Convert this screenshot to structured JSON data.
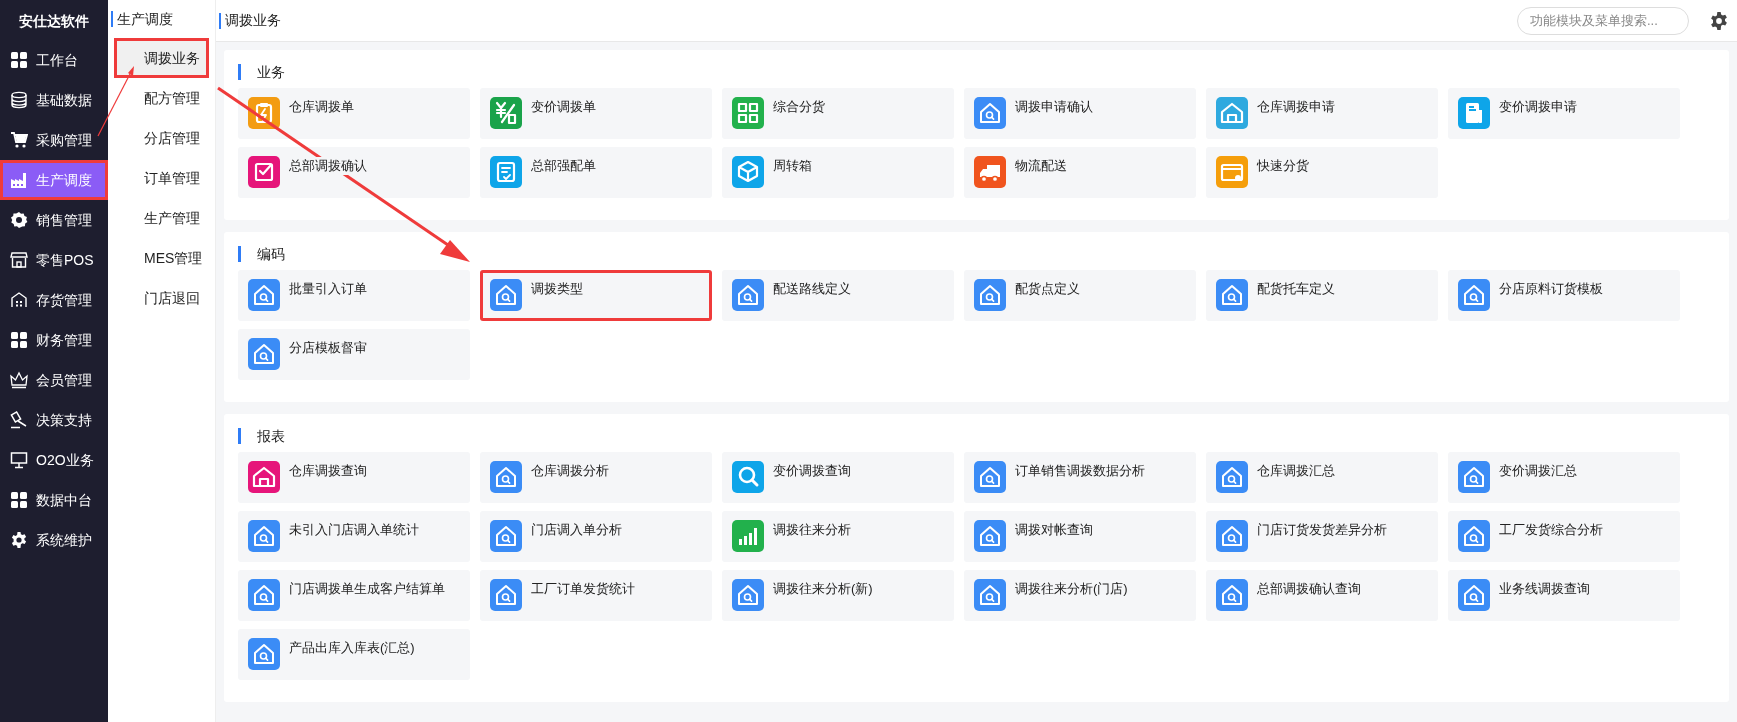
{
  "sidebar": {
    "logo": "安仕达软件",
    "items": [
      {
        "label": "工作台",
        "kind": "grid",
        "selected": false,
        "highlighted": false
      },
      {
        "label": "基础数据",
        "kind": "database",
        "selected": false,
        "highlighted": false
      },
      {
        "label": "采购管理",
        "kind": "cart",
        "selected": false,
        "highlighted": false
      },
      {
        "label": "生产调度",
        "kind": "factory",
        "selected": true,
        "highlighted": true
      },
      {
        "label": "销售管理",
        "kind": "sale",
        "selected": false,
        "highlighted": false
      },
      {
        "label": "零售POS",
        "kind": "store",
        "selected": false,
        "highlighted": false
      },
      {
        "label": "存货管理",
        "kind": "warehouse",
        "selected": false,
        "highlighted": false
      },
      {
        "label": "财务管理",
        "kind": "grid",
        "selected": false,
        "highlighted": false
      },
      {
        "label": "会员管理",
        "kind": "crown",
        "selected": false,
        "highlighted": false
      },
      {
        "label": "决策支持",
        "kind": "gavel",
        "selected": false,
        "highlighted": false
      },
      {
        "label": "O2O业务",
        "kind": "monitor",
        "selected": false,
        "highlighted": false
      },
      {
        "label": "数据中台",
        "kind": "grid",
        "selected": false,
        "highlighted": false
      },
      {
        "label": "系统维护",
        "kind": "gear",
        "selected": false,
        "highlighted": false
      }
    ]
  },
  "submenu": {
    "title": "生产调度",
    "items": [
      {
        "label": "调拨业务",
        "selected": true,
        "highlighted": true
      },
      {
        "label": "配方管理",
        "selected": false,
        "highlighted": false
      },
      {
        "label": "分店管理",
        "selected": false,
        "highlighted": false
      },
      {
        "label": "订单管理",
        "selected": false,
        "highlighted": false
      },
      {
        "label": "生产管理",
        "selected": false,
        "highlighted": false
      },
      {
        "label": "MES管理",
        "selected": false,
        "highlighted": false
      },
      {
        "label": "门店退回",
        "selected": false,
        "highlighted": false
      }
    ]
  },
  "header": {
    "title": "调拨业务",
    "search": {
      "placeholder": "功能模块及菜单搜索..."
    }
  },
  "sections": [
    {
      "title": "业务",
      "tiles": [
        {
          "label": "仓库调拨单",
          "kind": "clipboard",
          "color": "#f39c12",
          "highlighted": false
        },
        {
          "label": "变价调拨单",
          "kind": "yen",
          "color": "#1aa34a",
          "highlighted": false
        },
        {
          "label": "综合分货",
          "kind": "grid",
          "color": "#22b14c",
          "highlighted": false
        },
        {
          "label": "调拨申请确认",
          "kind": "house-search",
          "color": "#3b8cf6",
          "highlighted": false
        },
        {
          "label": "仓库调拨申请",
          "kind": "house",
          "color": "#2ea9df",
          "highlighted": false
        },
        {
          "label": "变价调拨申请",
          "kind": "document",
          "color": "#0ea5e9",
          "highlighted": false
        },
        {
          "label": "总部调拨确认",
          "kind": "check",
          "color": "#e6157a",
          "highlighted": false
        },
        {
          "label": "总部强配单",
          "kind": "form",
          "color": "#0ea5e9",
          "highlighted": false
        },
        {
          "label": "周转箱",
          "kind": "box",
          "color": "#0ea5e9",
          "highlighted": false
        },
        {
          "label": "物流配送",
          "kind": "truck",
          "color": "#f0541e",
          "highlighted": false
        },
        {
          "label": "快速分货",
          "kind": "card",
          "color": "#f59e0b",
          "highlighted": false
        }
      ]
    },
    {
      "title": "编码",
      "tiles": [
        {
          "label": "批量引入订单",
          "kind": "house-search",
          "color": "#3b8cf6",
          "highlighted": false
        },
        {
          "label": "调拨类型",
          "kind": "house-search",
          "color": "#3b8cf6",
          "highlighted": true
        },
        {
          "label": "配送路线定义",
          "kind": "house-search",
          "color": "#3b8cf6",
          "highlighted": false
        },
        {
          "label": "配货点定义",
          "kind": "house-search",
          "color": "#3b8cf6",
          "highlighted": false
        },
        {
          "label": "配货托车定义",
          "kind": "house-search",
          "color": "#3b8cf6",
          "highlighted": false
        },
        {
          "label": "分店原料订货模板",
          "kind": "house-search",
          "color": "#3b8cf6",
          "highlighted": false
        },
        {
          "label": "分店模板督审",
          "kind": "house-search",
          "color": "#3b8cf6",
          "highlighted": false
        }
      ]
    },
    {
      "title": "报表",
      "tiles": [
        {
          "label": "仓库调拨查询",
          "kind": "house",
          "color": "#e6157a",
          "highlighted": false
        },
        {
          "label": "仓库调拨分析",
          "kind": "house-search",
          "color": "#3b8cf6",
          "highlighted": false
        },
        {
          "label": "变价调拨查询",
          "kind": "search",
          "color": "#0ea5e9",
          "highlighted": false
        },
        {
          "label": "订单销售调拨数据分析",
          "kind": "house-search",
          "color": "#3b8cf6",
          "highlighted": false
        },
        {
          "label": "仓库调拨汇总",
          "kind": "house-search",
          "color": "#3b8cf6",
          "highlighted": false
        },
        {
          "label": "变价调拨汇总",
          "kind": "house-search",
          "color": "#3b8cf6",
          "highlighted": false
        },
        {
          "label": "未引入门店调入单统计",
          "kind": "house-search",
          "color": "#3b8cf6",
          "highlighted": false
        },
        {
          "label": "门店调入单分析",
          "kind": "house-search",
          "color": "#3b8cf6",
          "highlighted": false
        },
        {
          "label": "调拨往来分析",
          "kind": "chart",
          "color": "#22b14c",
          "highlighted": false
        },
        {
          "label": "调拨对帐查询",
          "kind": "house-search",
          "color": "#3b8cf6",
          "highlighted": false
        },
        {
          "label": "门店订货发货差异分析",
          "kind": "house-search",
          "color": "#3b8cf6",
          "highlighted": false
        },
        {
          "label": "工厂发货综合分析",
          "kind": "house-search",
          "color": "#3b8cf6",
          "highlighted": false
        },
        {
          "label": "门店调拨单生成客户结算单",
          "kind": "house-search",
          "color": "#3b8cf6",
          "highlighted": false
        },
        {
          "label": "工厂订单发货统计",
          "kind": "house-search",
          "color": "#3b8cf6",
          "highlighted": false
        },
        {
          "label": "调拨往来分析(新)",
          "kind": "house-search",
          "color": "#3b8cf6",
          "highlighted": false
        },
        {
          "label": "调拨往来分析(门店)",
          "kind": "house-search",
          "color": "#3b8cf6",
          "highlighted": false
        },
        {
          "label": "总部调拨确认查询",
          "kind": "house-search",
          "color": "#3b8cf6",
          "highlighted": false
        },
        {
          "label": "业务线调拨查询",
          "kind": "house-search",
          "color": "#3b8cf6",
          "highlighted": false
        },
        {
          "label": "产品出库入库表(汇总)",
          "kind": "house-search",
          "color": "#3b8cf6",
          "highlighted": false
        }
      ]
    }
  ]
}
